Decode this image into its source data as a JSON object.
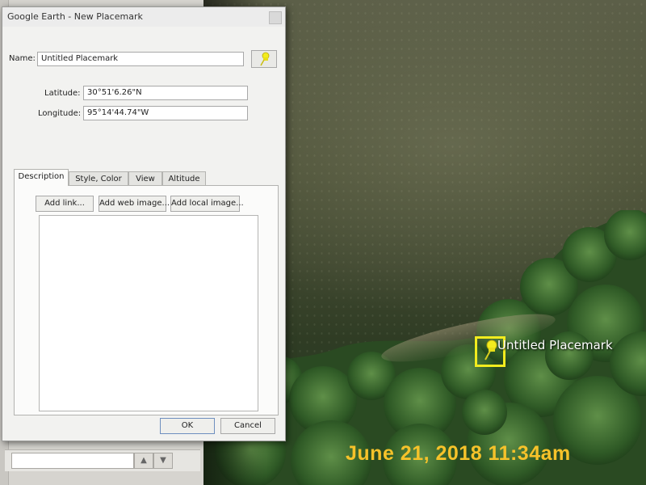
{
  "dialog": {
    "title": "Google Earth - New Placemark",
    "name_label": "Name:",
    "name_value": "Untitled Placemark",
    "latitude_label": "Latitude:",
    "latitude_value": "30°51'6.26\"N",
    "longitude_label": "Longitude:",
    "longitude_value": "95°14'44.74\"W",
    "tabs": [
      {
        "label": "Description",
        "active": true
      },
      {
        "label": "Style, Color",
        "active": false
      },
      {
        "label": "View",
        "active": false
      },
      {
        "label": "Altitude",
        "active": false
      }
    ],
    "description_buttons": {
      "add_link": "Add link...",
      "add_web_image": "Add web image...",
      "add_local_image": "Add local image..."
    },
    "ok_label": "OK",
    "cancel_label": "Cancel"
  },
  "map": {
    "placemark_label": "Untitled Placemark",
    "timestamp": "June 21, 2018 11:34am"
  },
  "icons": {
    "placemark": "yellow-pushpin-icon",
    "close": "close-icon",
    "arrow_up": "arrow-up-icon",
    "arrow_down": "arrow-down-icon"
  },
  "colors": {
    "pin": "#f2ec1e",
    "timestamp": "#f6c22a",
    "placemark_label": "#ffffff"
  }
}
